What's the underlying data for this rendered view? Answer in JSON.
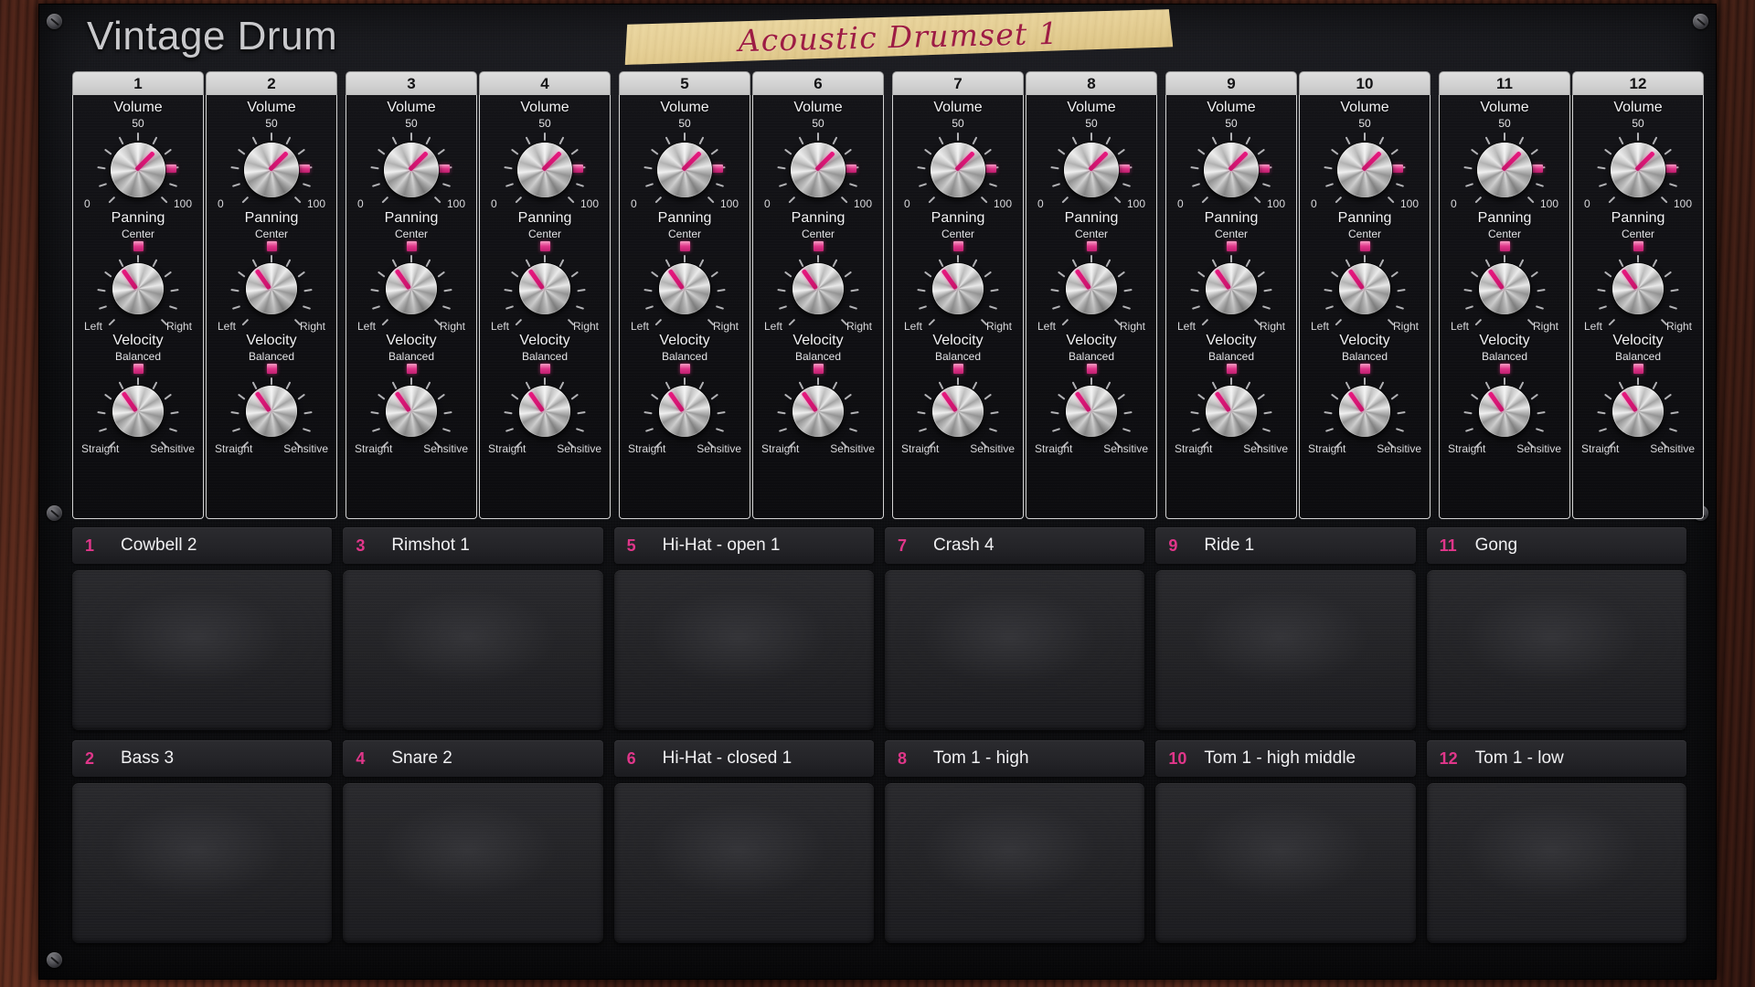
{
  "app": {
    "title": "Vintage Drum",
    "preset_name": "Acoustic Drumset 1",
    "accent_color": "#e0368a",
    "title_color": "#c9c9cc",
    "preset_text_color": "#9d1c44"
  },
  "sections": {
    "volume_label": "Volume",
    "volume_value": "50",
    "volume_min": "0",
    "volume_max": "100",
    "panning_label": "Panning",
    "panning_value": "Center",
    "panning_min": "Left",
    "panning_max": "Right",
    "velocity_label": "Velocity",
    "velocity_value": "Balanced",
    "velocity_min": "Straight",
    "velocity_max": "Sensitive"
  },
  "channels": [
    {
      "number": "1",
      "volume": "50",
      "panning": "Center",
      "velocity": "Balanced"
    },
    {
      "number": "2",
      "volume": "50",
      "panning": "Center",
      "velocity": "Balanced"
    },
    {
      "number": "3",
      "volume": "50",
      "panning": "Center",
      "velocity": "Balanced"
    },
    {
      "number": "4",
      "volume": "50",
      "panning": "Center",
      "velocity": "Balanced"
    },
    {
      "number": "5",
      "volume": "50",
      "panning": "Center",
      "velocity": "Balanced"
    },
    {
      "number": "6",
      "volume": "50",
      "panning": "Center",
      "velocity": "Balanced"
    },
    {
      "number": "7",
      "volume": "50",
      "panning": "Center",
      "velocity": "Balanced"
    },
    {
      "number": "8",
      "volume": "50",
      "panning": "Center",
      "velocity": "Balanced"
    },
    {
      "number": "9",
      "volume": "50",
      "panning": "Center",
      "velocity": "Balanced"
    },
    {
      "number": "10",
      "volume": "50",
      "panning": "Center",
      "velocity": "Balanced"
    },
    {
      "number": "11",
      "volume": "50",
      "panning": "Center",
      "velocity": "Balanced"
    },
    {
      "number": "12",
      "volume": "50",
      "panning": "Center",
      "velocity": "Balanced"
    }
  ],
  "pads": {
    "row_top": [
      {
        "number": "1",
        "name": "Cowbell 2"
      },
      {
        "number": "3",
        "name": "Rimshot 1"
      },
      {
        "number": "5",
        "name": "Hi-Hat - open 1"
      },
      {
        "number": "7",
        "name": "Crash 4"
      },
      {
        "number": "9",
        "name": "Ride 1"
      },
      {
        "number": "11",
        "name": "Gong"
      }
    ],
    "row_bottom": [
      {
        "number": "2",
        "name": "Bass 3"
      },
      {
        "number": "4",
        "name": "Snare 2"
      },
      {
        "number": "6",
        "name": "Hi-Hat - closed 1"
      },
      {
        "number": "8",
        "name": "Tom 1 - high"
      },
      {
        "number": "10",
        "name": "Tom 1 - high middle"
      },
      {
        "number": "12",
        "name": "Tom 1 - low"
      }
    ]
  }
}
